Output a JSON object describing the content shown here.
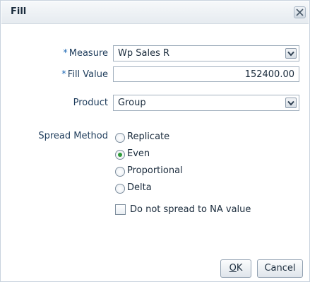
{
  "dialog": {
    "title": "Fill",
    "close_icon": "close-icon"
  },
  "form": {
    "required_marker": "*",
    "measure": {
      "label": "Measure",
      "value": "Wp Sales R"
    },
    "fill_value": {
      "label": "Fill Value",
      "value": "152400.00"
    },
    "product": {
      "label": "Product",
      "value": "Group"
    },
    "spread_method": {
      "label": "Spread Method",
      "options": [
        "Replicate",
        "Even",
        "Proportional",
        "Delta"
      ],
      "selected": "Even"
    },
    "no_spread_na": {
      "label": "Do not spread to NA value",
      "checked": false
    }
  },
  "buttons": {
    "ok_mnemonic": "O",
    "ok_rest": "K",
    "cancel": "Cancel"
  },
  "colors": {
    "required": "#1f6ab5",
    "radio_selected": "#2f9b3a",
    "border": "#a2b0be"
  }
}
